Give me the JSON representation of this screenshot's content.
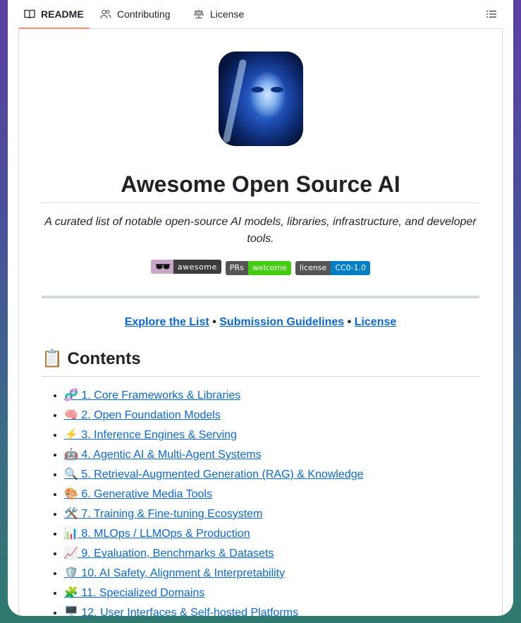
{
  "tabs": [
    {
      "label": "README",
      "icon": "book-icon",
      "active": true
    },
    {
      "label": "Contributing",
      "icon": "people-icon",
      "active": false
    },
    {
      "label": "License",
      "icon": "law-icon",
      "active": false
    }
  ],
  "readme": {
    "title": "Awesome Open Source AI",
    "tagline": "A curated list of notable open-source AI models, libraries, infrastructure, and developer tools.",
    "badges": {
      "awesome": {
        "right": "awesome"
      },
      "prs": {
        "left": "PRs",
        "right": "welcome"
      },
      "license": {
        "left": "license",
        "right": "CC0-1.0"
      }
    },
    "nav_links": {
      "explore": "Explore the List",
      "guidelines": "Submission Guidelines",
      "license": "License",
      "separator": "•"
    },
    "contents_heading": "📋 Contents",
    "contents": [
      {
        "emoji": "🧬",
        "label": "1. Core Frameworks & Libraries"
      },
      {
        "emoji": "🧠",
        "label": "2. Open Foundation Models"
      },
      {
        "emoji": "⚡",
        "label": "3. Inference Engines & Serving"
      },
      {
        "emoji": "🤖",
        "label": "4. Agentic AI & Multi-Agent Systems"
      },
      {
        "emoji": "🔍",
        "label": "5. Retrieval-Augmented Generation (RAG) & Knowledge"
      },
      {
        "emoji": "🎨",
        "label": "6. Generative Media Tools"
      },
      {
        "emoji": "🛠️",
        "label": "7. Training & Fine-tuning Ecosystem"
      },
      {
        "emoji": "📊",
        "label": "8. MLOps / LLMOps & Production"
      },
      {
        "emoji": "📈",
        "label": "9. Evaluation, Benchmarks & Datasets"
      },
      {
        "emoji": "🛡️",
        "label": "10. AI Safety, Alignment & Interpretability"
      },
      {
        "emoji": "🧩",
        "label": "11. Specialized Domains"
      },
      {
        "emoji": "🖥️",
        "label": "12. User Interfaces & Self-hosted Platforms"
      }
    ]
  },
  "colors": {
    "link": "#0969da",
    "active_tab_underline": "#fd8c73",
    "badge_green": "#44cc11",
    "badge_blue": "#007ec6"
  }
}
